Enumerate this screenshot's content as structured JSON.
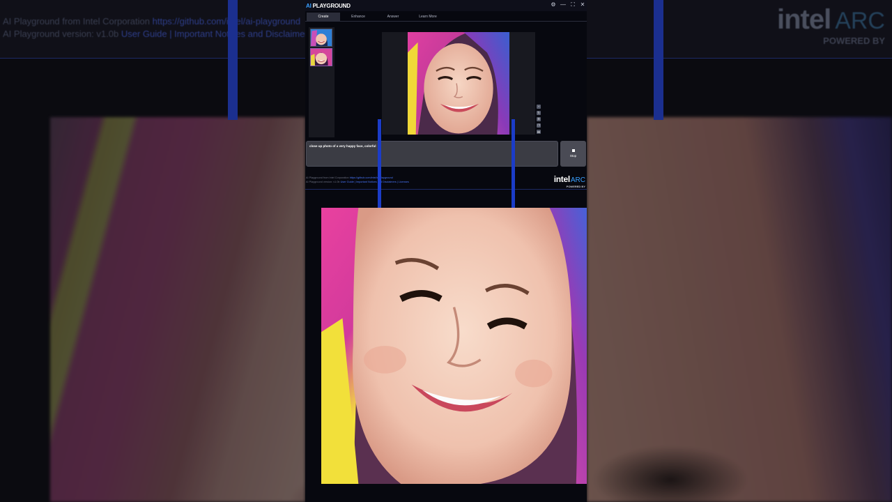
{
  "app": {
    "title_prefix": "AI",
    "title_rest": " PLAYGROUND",
    "window_controls": [
      "⚙",
      "—",
      "⛶",
      "✕"
    ]
  },
  "tabs": [
    {
      "label": "Create",
      "active": true
    },
    {
      "label": "Enhance",
      "active": false
    },
    {
      "label": "Answer",
      "active": false
    },
    {
      "label": "Learn More",
      "active": false
    }
  ],
  "prompt": {
    "text": "close up photo of a very happy face, colorful"
  },
  "stop_button": {
    "label": "Stop"
  },
  "footer": {
    "line1_text": "AI Playground from Intel Corporation ",
    "line1_link": "https://github.com/intel/ai-playground",
    "line2_text": "AI Playground version: v1.0b ",
    "line2_links": "User Guide | Important Notices and Disclaimers | Licenses"
  },
  "logo": {
    "intel": "intel",
    "arc": "ARC",
    "powered": "POWERED BY"
  },
  "background": {
    "header_line1_text": "AI Playground from Intel Corporation ",
    "header_line1_link": "https://github.com/intel/ai-playground",
    "header_line2_text": "AI Playground version: v1.0b ",
    "header_line2_links": "User Guide | Important Notices and Disclaimers | Li",
    "logo_intel": "intel",
    "logo_arc": "ARC",
    "logo_powered": "POWERED BY"
  },
  "tools": [
    "magnify-icon",
    "refresh-icon",
    "settings-icon",
    "copy-icon",
    "folder-icon"
  ],
  "colors": {
    "accent": "#3aa0ff",
    "link": "#4a78ff",
    "bar_blue": "#1b3cc8"
  }
}
